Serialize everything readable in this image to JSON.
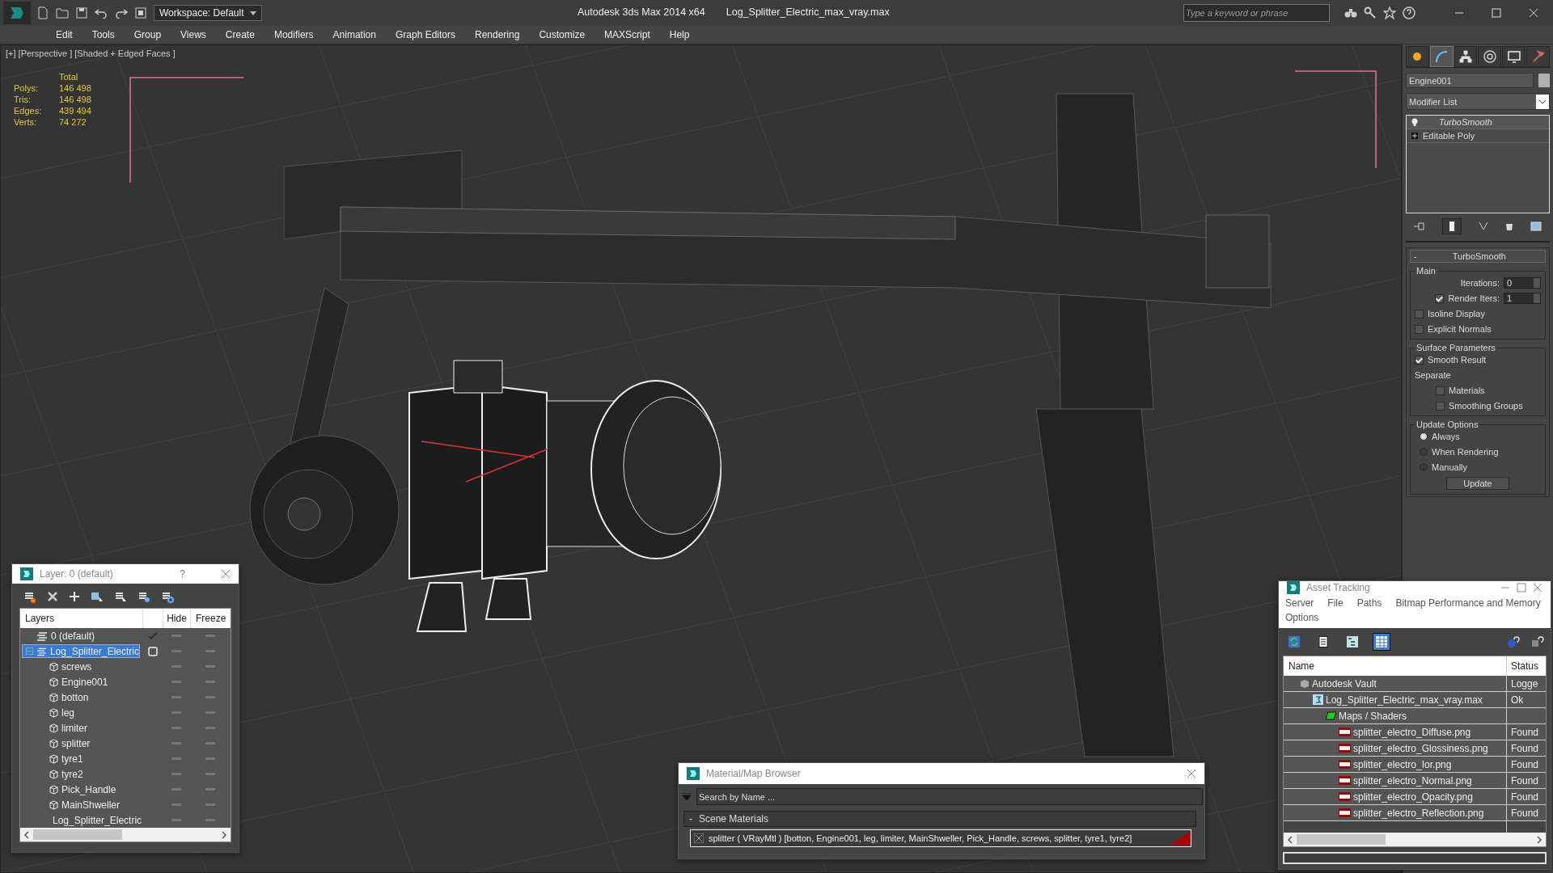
{
  "title_bar": {
    "workspace": "Workspace: Default",
    "app_title": "Autodesk 3ds Max  2014 x64",
    "file_name": "Log_Splitter_Electric_max_vray.max",
    "search": {
      "placeholder": "Type a keyword or phrase"
    }
  },
  "menu_bar": [
    "Edit",
    "Tools",
    "Group",
    "Views",
    "Create",
    "Modifiers",
    "Animation",
    "Graph Editors",
    "Rendering",
    "Customize",
    "MAXScript",
    "Help"
  ],
  "viewport": {
    "label": "[+] [Perspective ] [Shaded + Edged Faces ]",
    "stats": {
      "header": "Total",
      "rows": [
        {
          "label": "Polys:",
          "value": "146 498"
        },
        {
          "label": "Tris:",
          "value": "146 498"
        },
        {
          "label": "Edges:",
          "value": "439 494"
        },
        {
          "label": "Verts:",
          "value": "74 272"
        }
      ]
    }
  },
  "command_panel": {
    "tabs": [
      {
        "kind": "create",
        "selected": false
      },
      {
        "kind": "modify",
        "selected": true
      },
      {
        "kind": "hierarchy",
        "selected": false
      },
      {
        "kind": "motion",
        "selected": false
      },
      {
        "kind": "display",
        "selected": false
      },
      {
        "kind": "utilities",
        "selected": false
      }
    ],
    "object_name": "Engine001",
    "modifier_list": "Modifier List",
    "stack": [
      {
        "kind": "modifier",
        "label": "TurboSmooth"
      },
      {
        "kind": "base",
        "label": "Editable Poly"
      }
    ],
    "rollout": {
      "collapse": "-",
      "title": "TurboSmooth",
      "main": {
        "title": "Main",
        "iterations": {
          "label": "Iterations:",
          "value": "0"
        },
        "render_iters": {
          "label": "Render Iters:",
          "value": "1",
          "checked": true
        },
        "options": [
          {
            "label": "Isoline Display",
            "checked": false
          },
          {
            "label": "Explicit Normals",
            "checked": false
          }
        ]
      },
      "surface": {
        "title": "Surface Parameters",
        "smooth_result": {
          "label": "Smooth Result",
          "checked": true
        },
        "separate": "Separate",
        "separate_options": [
          {
            "label": "Materials",
            "checked": false
          },
          {
            "label": "Smoothing Groups",
            "checked": false
          }
        ]
      },
      "update": {
        "title": "Update Options",
        "options": [
          {
            "label": "Always",
            "selected": true
          },
          {
            "label": "When Rendering",
            "selected": false
          },
          {
            "label": "Manually",
            "selected": false
          }
        ],
        "button": "Update"
      }
    }
  },
  "layer_dialog": {
    "title": "Layer: 0 (default)",
    "help": "?",
    "columns": [
      "Layers",
      "Hide",
      "Freeze"
    ],
    "layers": [
      {
        "name": "0 (default)",
        "kind": "layer",
        "current": true,
        "selected": false
      },
      {
        "name": "Log_Splitter_Electric",
        "kind": "layer",
        "current": false,
        "selected": true,
        "expanded": true,
        "children": [
          {
            "name": "screws",
            "kind": "object"
          },
          {
            "name": "Engine001",
            "kind": "object"
          },
          {
            "name": "botton",
            "kind": "object"
          },
          {
            "name": "leg",
            "kind": "object"
          },
          {
            "name": "limiter",
            "kind": "object"
          },
          {
            "name": "splitter",
            "kind": "object"
          },
          {
            "name": "tyre1",
            "kind": "object"
          },
          {
            "name": "tyre2",
            "kind": "object"
          },
          {
            "name": "Pick_Handle",
            "kind": "object"
          },
          {
            "name": "MainShweller",
            "kind": "object"
          },
          {
            "name": "Log_Splitter_Electric",
            "kind": "object"
          }
        ]
      }
    ]
  },
  "asset_tracking": {
    "title": "Asset Tracking",
    "menu": [
      "Server",
      "File",
      "Paths",
      "Bitmap Performance and Memory",
      "Options"
    ],
    "toolbar": [
      {
        "kind": "refresh",
        "selected": false
      },
      {
        "kind": "list",
        "selected": false
      },
      {
        "kind": "tree",
        "selected": false
      },
      {
        "kind": "table",
        "selected": true
      }
    ],
    "columns": [
      "Name",
      "Status"
    ],
    "assets": [
      {
        "name": "Autodesk Vault",
        "kind": "vault",
        "status": "Logge",
        "children": [
          {
            "name": "Log_Splitter_Electric_max_vray.max",
            "kind": "max",
            "status": "Ok",
            "children": [
              {
                "name": "Maps / Shaders",
                "kind": "folder",
                "children": [
                  {
                    "name": "splitter_electro_Diffuse.png",
                    "kind": "png",
                    "status": "Found"
                  },
                  {
                    "name": "splitter_electro_Glossiness.png",
                    "kind": "png",
                    "status": "Found"
                  },
                  {
                    "name": "splitter_electro_Ior.png",
                    "kind": "png",
                    "status": "Found"
                  },
                  {
                    "name": "splitter_electro_Normal.png",
                    "kind": "png",
                    "status": "Found"
                  },
                  {
                    "name": "splitter_electro_Opacity.png",
                    "kind": "png",
                    "status": "Found"
                  },
                  {
                    "name": "splitter_electro_Reflection.png",
                    "kind": "png",
                    "status": "Found"
                  }
                ]
              }
            ]
          }
        ]
      }
    ]
  },
  "material_browser": {
    "title": "Material/Map Browser",
    "search": {
      "placeholder": "Search by Name ..."
    },
    "group": {
      "collapse": "-",
      "title": "Scene Materials"
    },
    "materials": [
      "splitter  ( VRayMtl )  [botton, Engine001, leg, limiter, MainShweller, Pick_Handle, screws, splitter, tyre1, tyre2]"
    ]
  }
}
